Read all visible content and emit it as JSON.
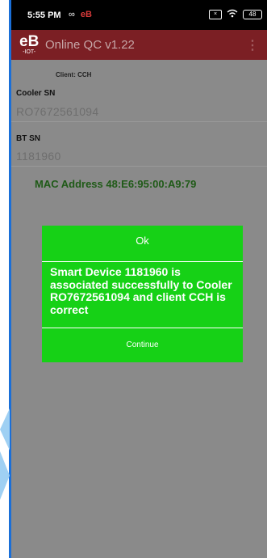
{
  "status_bar": {
    "time": "5:55 PM",
    "link_icon": "link-icon",
    "app_badge": "eB",
    "battery": "48"
  },
  "app_bar": {
    "logo": "eB",
    "logo_sub": "-IOT-",
    "title": "Online QC v1.22",
    "menu_icon": "⋮"
  },
  "form": {
    "client_label": "Client: CCH",
    "cooler_sn_label": "Cooler SN",
    "cooler_sn_value": "RO7672561094",
    "bt_sn_label": "BT SN",
    "bt_sn_value": "1181960",
    "mac_text": "MAC Address 48:E6:95:00:A9:79"
  },
  "dialog": {
    "title": "Ok",
    "message": "Smart Device 1181960 is associated successfully to Cooler RO7672561094 and client CCH is correct",
    "button_label": "Continue"
  },
  "colors": {
    "app_bar": "#7b1f24",
    "dialog": "#16d116",
    "mac_text": "#1f5a17",
    "overlay": "#8a8a8a"
  }
}
